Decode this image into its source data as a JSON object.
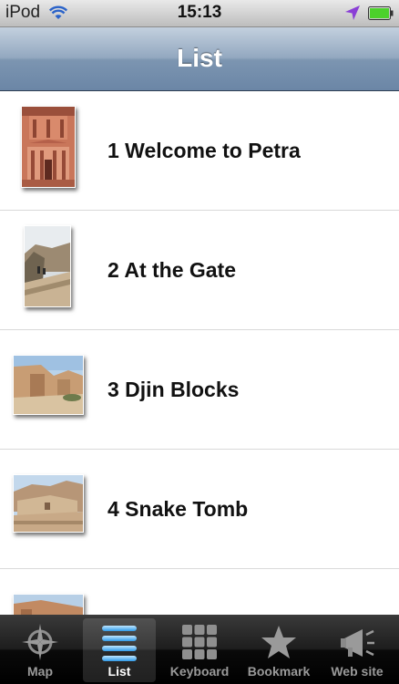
{
  "status_bar": {
    "carrier": "iPod",
    "time": "15:13"
  },
  "nav": {
    "title": "List"
  },
  "list": {
    "items": [
      {
        "label": "1 Welcome to Petra"
      },
      {
        "label": "2 At the Gate"
      },
      {
        "label": "3 Djin Blocks"
      },
      {
        "label": "4 Snake Tomb"
      },
      {
        "label": ""
      }
    ]
  },
  "tabs": [
    {
      "label": "Map",
      "icon": "compass-icon",
      "selected": false
    },
    {
      "label": "List",
      "icon": "list-icon",
      "selected": true
    },
    {
      "label": "Keyboard",
      "icon": "keypad-icon",
      "selected": false
    },
    {
      "label": "Bookmark",
      "icon": "star-icon",
      "selected": false
    },
    {
      "label": "Web site",
      "icon": "megaphone-icon",
      "selected": false
    }
  ],
  "colors": {
    "nav_bar": "#7c95b1",
    "tab_bar": "#000000",
    "selected_tab_icon": "#4fb6f5",
    "battery": "#4cd12b",
    "location_arrow": "#8a3fd6"
  }
}
